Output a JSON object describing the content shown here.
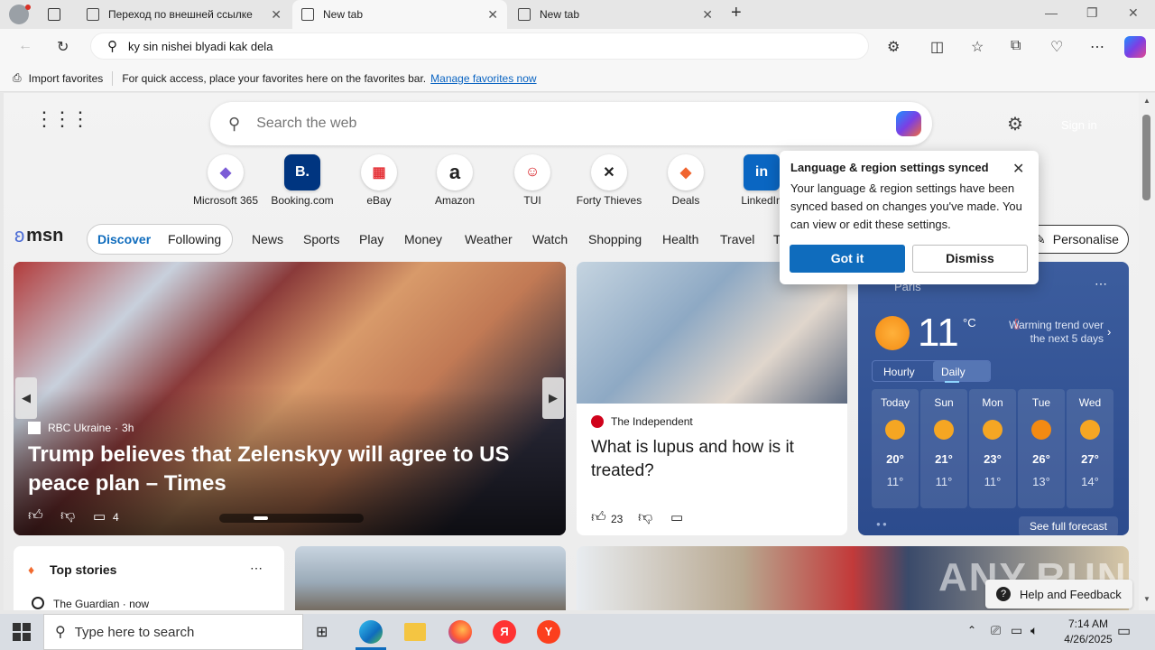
{
  "browser": {
    "tabs": [
      {
        "label": "Переход по внешней ссылке"
      },
      {
        "label": "New tab"
      },
      {
        "label": "New tab"
      }
    ],
    "address": "ky sin nishei blyadi kak dela",
    "favbar": {
      "import": "Import favorites",
      "hint": "For quick access, place your favorites here on the favorites bar.",
      "manage": "Manage favorites now"
    }
  },
  "newtab": {
    "search_placeholder": "Search the web",
    "signin": "Sign in",
    "quicklinks": [
      {
        "label": "Microsoft 365",
        "glyph": "◆"
      },
      {
        "label": "Booking.com",
        "glyph": "B."
      },
      {
        "label": "eBay",
        "glyph": "▦"
      },
      {
        "label": "Amazon",
        "glyph": "a"
      },
      {
        "label": "TUI",
        "glyph": "☺"
      },
      {
        "label": "Forty Thieves",
        "glyph": "✕"
      },
      {
        "label": "Deals",
        "glyph": "◆"
      },
      {
        "label": "LinkedIn",
        "glyph": "in"
      }
    ]
  },
  "msn": {
    "logo": "msn",
    "discover": "Discover",
    "following": "Following",
    "nav": [
      "News",
      "Sports",
      "Play",
      "Money",
      "Weather",
      "Watch",
      "Shopping",
      "Health",
      "Travel",
      "T"
    ],
    "personalise": "Personalise"
  },
  "hero": {
    "source": "RBC Ukraine",
    "time": "3h",
    "headline": "Trump believes that Zelenskyy will agree to US peace plan – Times",
    "comments": "4"
  },
  "card2": {
    "source": "The Independent",
    "headline": "What is lupus and how is it treated?",
    "likes": "23"
  },
  "weather": {
    "location": "Paris",
    "temp": "11",
    "unit": "°C",
    "trend": "Warming trend over the next 5 days",
    "tabs": [
      "Hourly",
      "Daily"
    ],
    "days": [
      {
        "d": "Today",
        "hi": "20°",
        "lo": "11°"
      },
      {
        "d": "Sun",
        "hi": "21°",
        "lo": "11°"
      },
      {
        "d": "Mon",
        "hi": "23°",
        "lo": "11°"
      },
      {
        "d": "Tue",
        "hi": "26°",
        "lo": "13°"
      },
      {
        "d": "Wed",
        "hi": "27°",
        "lo": "14°"
      }
    ],
    "forecast": "See full forecast"
  },
  "topstories": {
    "title": "Top stories",
    "source": "The Guardian",
    "time": "now"
  },
  "popup": {
    "title": "Language & region settings synced",
    "body": "Your language & region settings have been synced based on changes you've made. You can view or edit these settings.",
    "gotit": "Got it",
    "dismiss": "Dismiss"
  },
  "help": "Help and Feedback",
  "watermark": "ANY.RUN",
  "taskbar": {
    "search": "Type here to search",
    "time": "7:14 AM",
    "date": "4/26/2025"
  }
}
